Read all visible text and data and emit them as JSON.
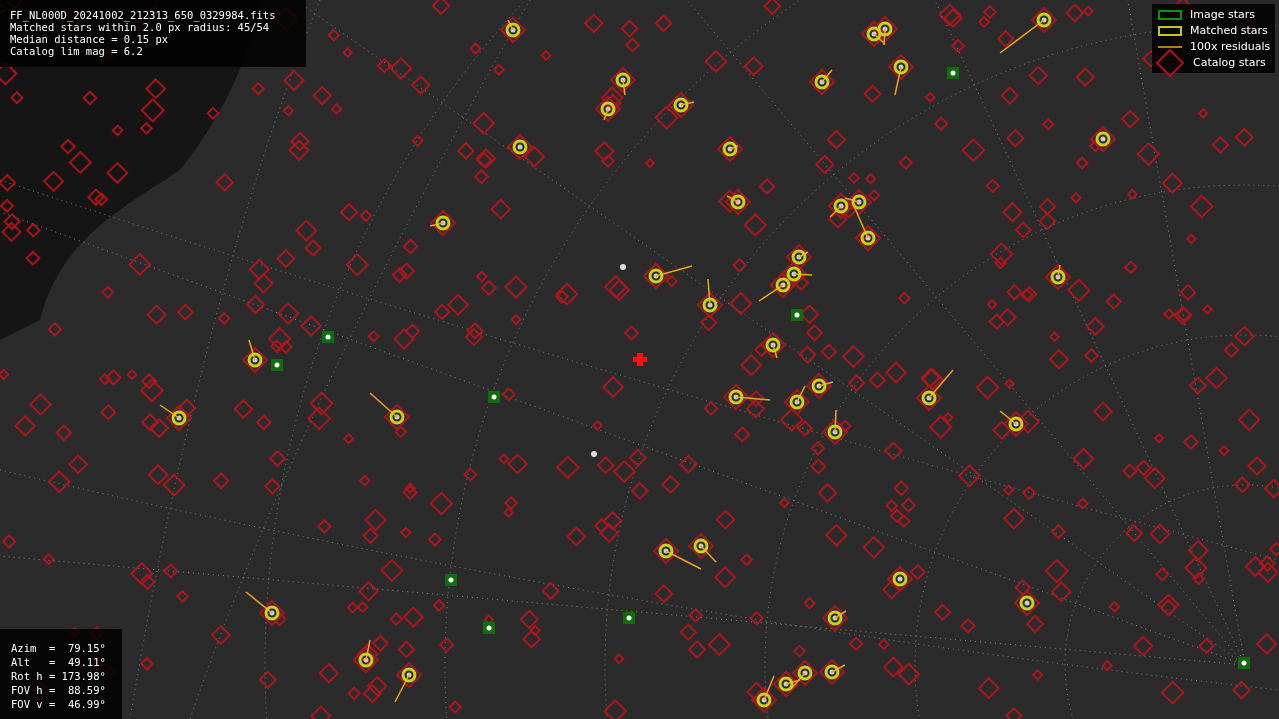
{
  "info": {
    "lines": [
      "FF_NL000D_20241002_212313_650_0329984.fits",
      "Matched stars within 2.0 px radius: 45/54",
      "Median distance = 0.15 px",
      "Catalog lim mag = 6.2"
    ]
  },
  "legend": [
    {
      "kind": "image",
      "label": "Image stars"
    },
    {
      "kind": "matched",
      "label": "Matched stars"
    },
    {
      "kind": "residual",
      "label": "100x residuals"
    },
    {
      "kind": "catalog",
      "label": "Catalog stars"
    }
  ],
  "pointing": {
    "lines": [
      "Azim  =  79.15°",
      "Alt   =  49.11°",
      "Rot h = 173.98°",
      "FOV h =  88.59°",
      "FOV v =  46.99°"
    ]
  }
}
